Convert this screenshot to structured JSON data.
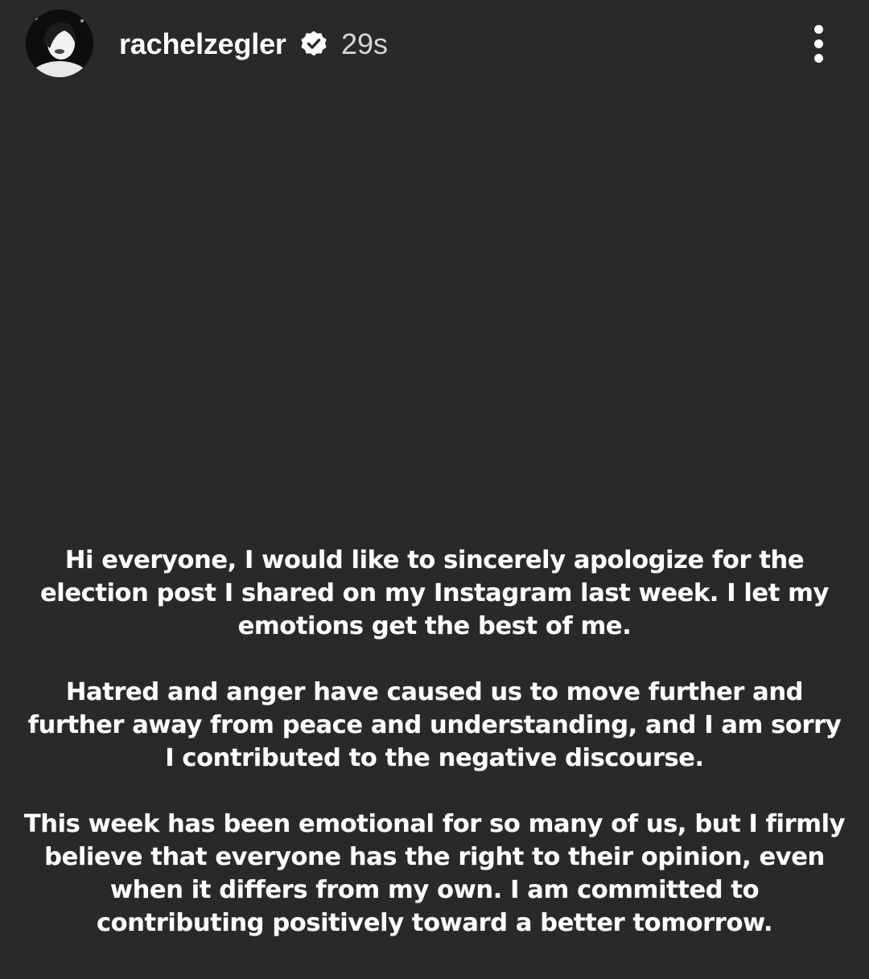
{
  "header": {
    "username": "rachelzegler",
    "timestamp": "29s",
    "verified_icon": "verified-badge-icon",
    "menu_icon": "more-vertical-icon"
  },
  "message": {
    "paragraphs": [
      {
        "lines": [
          "Hi everyone, I would like to sincerely apologize for the",
          "election post I shared on my Instagram last week. I let my",
          "emotions get the best of me."
        ]
      },
      {
        "lines": [
          "Hatred and anger have caused us to move further and",
          "further away from peace and understanding, and I am sorry",
          "I contributed to the negative discourse."
        ]
      },
      {
        "lines": [
          "This week has been emotional for so many of us, but I firmly",
          "believe that everyone has the right to their opinion, even",
          "when it differs from my own. I am committed to",
          "contributing positively toward a better tomorrow."
        ]
      }
    ]
  },
  "colors": {
    "background": "#2a2929",
    "text": "#ffffff",
    "timestamp": "#d6d6d6"
  }
}
